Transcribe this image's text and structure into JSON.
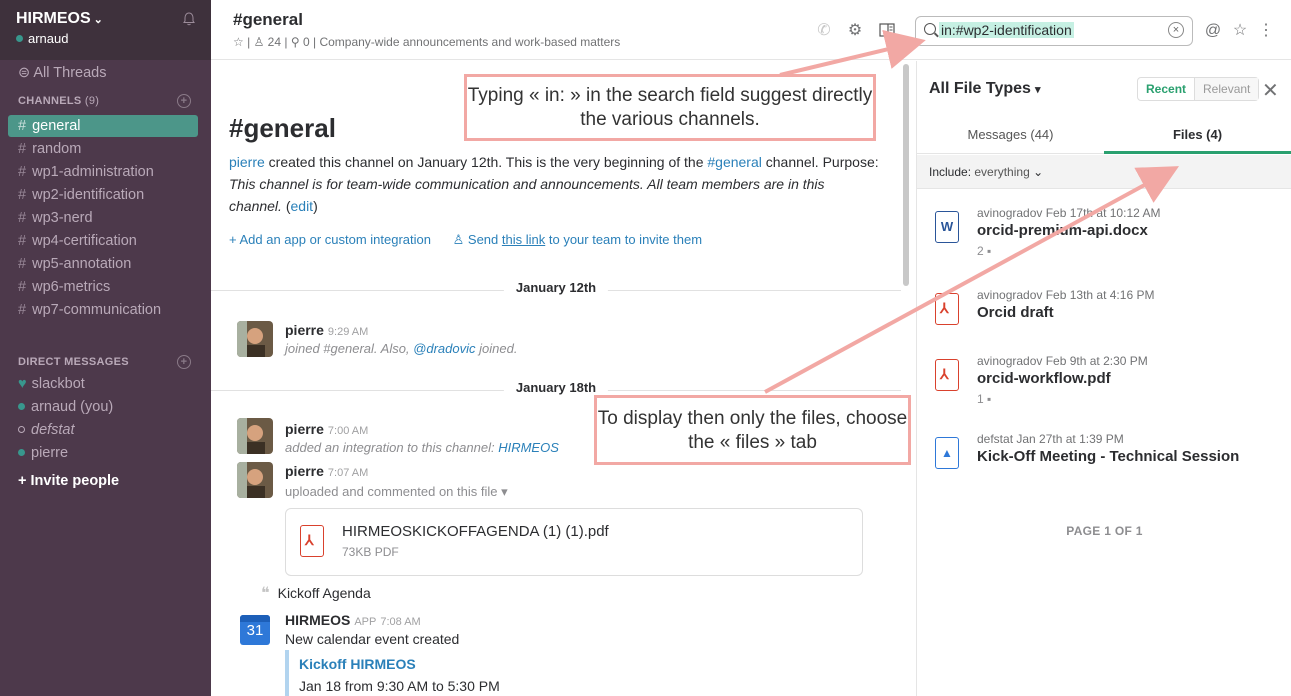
{
  "sidebar": {
    "team_name": "HIRMEOS",
    "user": "arnaud",
    "all_threads": "All Threads",
    "channels_header": "CHANNELS",
    "channels_count": "(9)",
    "channels": [
      "general",
      "random",
      "wp1-administration",
      "wp2-identification",
      "wp3-nerd",
      "wp4-certification",
      "wp5-annotation",
      "wp6-metrics",
      "wp7-communication"
    ],
    "dm_header": "DIRECT MESSAGES",
    "dms": [
      "slackbot",
      "arnaud (you)",
      "defstat",
      "pierre"
    ],
    "invite": "+ Invite people"
  },
  "header": {
    "channel": "#general",
    "members": "24",
    "pins": "0",
    "purpose": "Company-wide announcements and work-based matters",
    "search_value": "in:#wp2-identification"
  },
  "intro": {
    "title": "#general",
    "creator": "pierre",
    "created_text": " created this channel on January 12th. This is the very beginning of the ",
    "channel_link": "#general",
    "purpose_lead": " channel. Purpose: ",
    "purpose": "This channel is for team-wide communication and announcements. All team members are in this channel.",
    "edit": "edit",
    "add_app": "+ Add an app or custom integration",
    "send_pre": "Send ",
    "send_link": "this link",
    "send_post": " to your team to invite them"
  },
  "messages": {
    "day1": "January 12th",
    "m1_name": "pierre",
    "m1_time": "9:29 AM",
    "m1_text_pre": "joined #general. Also, ",
    "m1_mention": "@dradovic",
    "m1_text_post": " joined.",
    "day2": "January 18th",
    "m2_name": "pierre",
    "m2_time": "7:00 AM",
    "m2_text": "added an integration to this channel: ",
    "m2_link": "HIRMEOS",
    "m3_name": "pierre",
    "m3_time": "7:07 AM",
    "m3_text": "uploaded and commented on this file ▾",
    "file_name": "HIRMEOSKICKOFFAGENDA (1) (1).pdf",
    "file_size": "73KB PDF",
    "quote": "Kickoff Agenda",
    "app_name": "HIRMEOS",
    "app_badge": "APP",
    "app_time": "7:08 AM",
    "app_text": "New calendar event created",
    "cal_day": "31",
    "event_title": "Kickoff HIRMEOS",
    "event_time": "Jan 18 from 9:30 AM to 5:30 PM"
  },
  "panel": {
    "title": "All File Types",
    "recent": "Recent",
    "relevant": "Relevant",
    "tab_messages": "Messages (44)",
    "tab_files": "Files (4)",
    "include_label": "Include:",
    "include_value": "everything",
    "files": [
      {
        "meta": "avinogradov  Feb 17th at 10:12 AM",
        "title": "orcid-premium-api.docx",
        "comments": "2",
        "icon": "word-icon"
      },
      {
        "meta": "avinogradov  Feb 13th at 4:16 PM",
        "title": "Orcid draft",
        "comments": "",
        "icon": "pdf-icon"
      },
      {
        "meta": "avinogradov  Feb 9th at 2:30 PM",
        "title": "orcid-workflow.pdf",
        "comments": "1",
        "icon": "pdf-icon"
      },
      {
        "meta": "defstat  Jan 27th at 1:39 PM",
        "title": "Kick-Off Meeting - Technical Session",
        "comments": "",
        "icon": "google-drive-icon"
      }
    ],
    "page": "PAGE 1 OF 1"
  },
  "annotations": {
    "a1": "Typing « in: » in the search field suggest directly the various channels.",
    "a2": "To display then only the files, choose the « files » tab"
  },
  "colors": {
    "sidebar": "#4d394b",
    "active": "#4c9689",
    "accent_green": "#2aa06f",
    "link": "#2a80b9",
    "annotation": "#f2a8a4"
  }
}
